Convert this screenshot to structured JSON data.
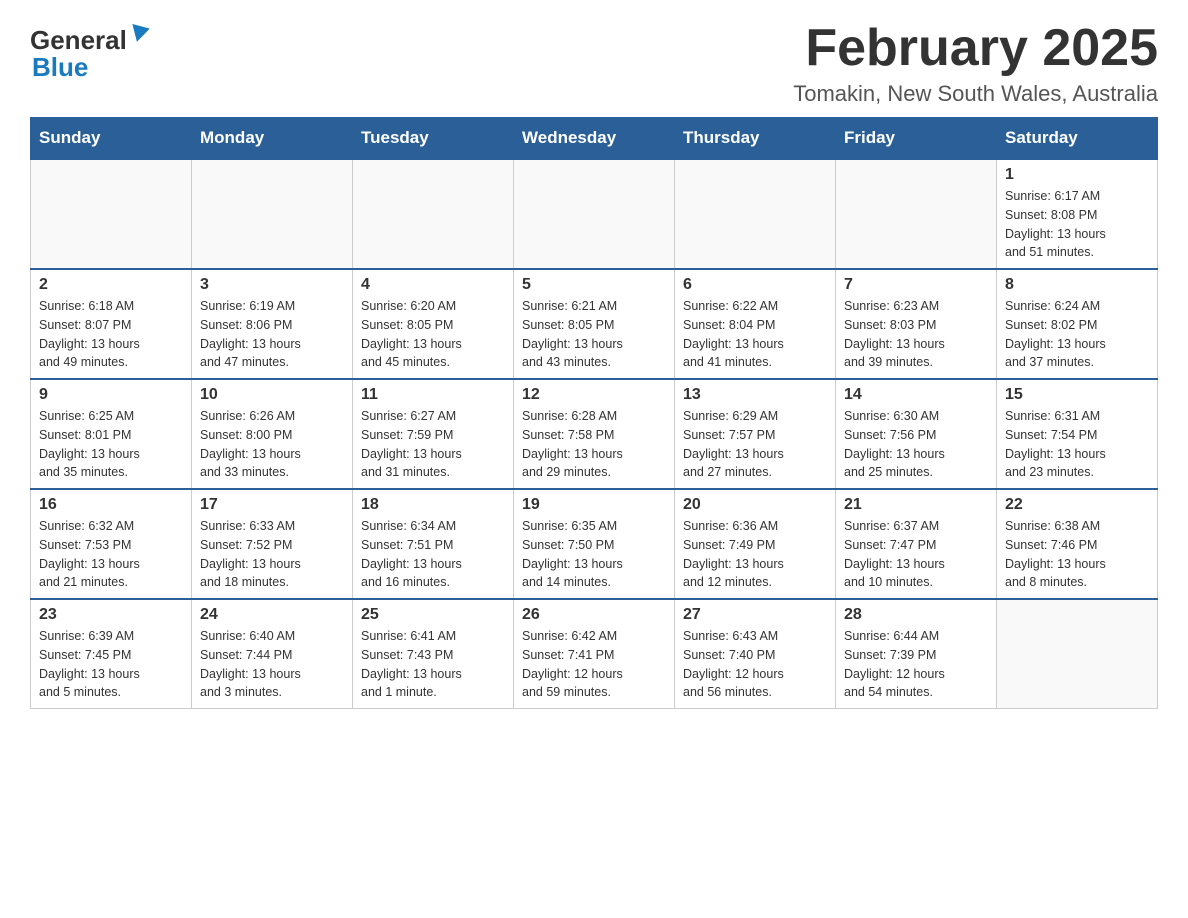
{
  "header": {
    "logo_general": "General",
    "logo_blue": "Blue",
    "month_title": "February 2025",
    "location": "Tomakin, New South Wales, Australia"
  },
  "weekdays": [
    "Sunday",
    "Monday",
    "Tuesday",
    "Wednesday",
    "Thursday",
    "Friday",
    "Saturday"
  ],
  "weeks": [
    [
      {
        "day": "",
        "info": ""
      },
      {
        "day": "",
        "info": ""
      },
      {
        "day": "",
        "info": ""
      },
      {
        "day": "",
        "info": ""
      },
      {
        "day": "",
        "info": ""
      },
      {
        "day": "",
        "info": ""
      },
      {
        "day": "1",
        "info": "Sunrise: 6:17 AM\nSunset: 8:08 PM\nDaylight: 13 hours\nand 51 minutes."
      }
    ],
    [
      {
        "day": "2",
        "info": "Sunrise: 6:18 AM\nSunset: 8:07 PM\nDaylight: 13 hours\nand 49 minutes."
      },
      {
        "day": "3",
        "info": "Sunrise: 6:19 AM\nSunset: 8:06 PM\nDaylight: 13 hours\nand 47 minutes."
      },
      {
        "day": "4",
        "info": "Sunrise: 6:20 AM\nSunset: 8:05 PM\nDaylight: 13 hours\nand 45 minutes."
      },
      {
        "day": "5",
        "info": "Sunrise: 6:21 AM\nSunset: 8:05 PM\nDaylight: 13 hours\nand 43 minutes."
      },
      {
        "day": "6",
        "info": "Sunrise: 6:22 AM\nSunset: 8:04 PM\nDaylight: 13 hours\nand 41 minutes."
      },
      {
        "day": "7",
        "info": "Sunrise: 6:23 AM\nSunset: 8:03 PM\nDaylight: 13 hours\nand 39 minutes."
      },
      {
        "day": "8",
        "info": "Sunrise: 6:24 AM\nSunset: 8:02 PM\nDaylight: 13 hours\nand 37 minutes."
      }
    ],
    [
      {
        "day": "9",
        "info": "Sunrise: 6:25 AM\nSunset: 8:01 PM\nDaylight: 13 hours\nand 35 minutes."
      },
      {
        "day": "10",
        "info": "Sunrise: 6:26 AM\nSunset: 8:00 PM\nDaylight: 13 hours\nand 33 minutes."
      },
      {
        "day": "11",
        "info": "Sunrise: 6:27 AM\nSunset: 7:59 PM\nDaylight: 13 hours\nand 31 minutes."
      },
      {
        "day": "12",
        "info": "Sunrise: 6:28 AM\nSunset: 7:58 PM\nDaylight: 13 hours\nand 29 minutes."
      },
      {
        "day": "13",
        "info": "Sunrise: 6:29 AM\nSunset: 7:57 PM\nDaylight: 13 hours\nand 27 minutes."
      },
      {
        "day": "14",
        "info": "Sunrise: 6:30 AM\nSunset: 7:56 PM\nDaylight: 13 hours\nand 25 minutes."
      },
      {
        "day": "15",
        "info": "Sunrise: 6:31 AM\nSunset: 7:54 PM\nDaylight: 13 hours\nand 23 minutes."
      }
    ],
    [
      {
        "day": "16",
        "info": "Sunrise: 6:32 AM\nSunset: 7:53 PM\nDaylight: 13 hours\nand 21 minutes."
      },
      {
        "day": "17",
        "info": "Sunrise: 6:33 AM\nSunset: 7:52 PM\nDaylight: 13 hours\nand 18 minutes."
      },
      {
        "day": "18",
        "info": "Sunrise: 6:34 AM\nSunset: 7:51 PM\nDaylight: 13 hours\nand 16 minutes."
      },
      {
        "day": "19",
        "info": "Sunrise: 6:35 AM\nSunset: 7:50 PM\nDaylight: 13 hours\nand 14 minutes."
      },
      {
        "day": "20",
        "info": "Sunrise: 6:36 AM\nSunset: 7:49 PM\nDaylight: 13 hours\nand 12 minutes."
      },
      {
        "day": "21",
        "info": "Sunrise: 6:37 AM\nSunset: 7:47 PM\nDaylight: 13 hours\nand 10 minutes."
      },
      {
        "day": "22",
        "info": "Sunrise: 6:38 AM\nSunset: 7:46 PM\nDaylight: 13 hours\nand 8 minutes."
      }
    ],
    [
      {
        "day": "23",
        "info": "Sunrise: 6:39 AM\nSunset: 7:45 PM\nDaylight: 13 hours\nand 5 minutes."
      },
      {
        "day": "24",
        "info": "Sunrise: 6:40 AM\nSunset: 7:44 PM\nDaylight: 13 hours\nand 3 minutes."
      },
      {
        "day": "25",
        "info": "Sunrise: 6:41 AM\nSunset: 7:43 PM\nDaylight: 13 hours\nand 1 minute."
      },
      {
        "day": "26",
        "info": "Sunrise: 6:42 AM\nSunset: 7:41 PM\nDaylight: 12 hours\nand 59 minutes."
      },
      {
        "day": "27",
        "info": "Sunrise: 6:43 AM\nSunset: 7:40 PM\nDaylight: 12 hours\nand 56 minutes."
      },
      {
        "day": "28",
        "info": "Sunrise: 6:44 AM\nSunset: 7:39 PM\nDaylight: 12 hours\nand 54 minutes."
      },
      {
        "day": "",
        "info": ""
      }
    ]
  ]
}
